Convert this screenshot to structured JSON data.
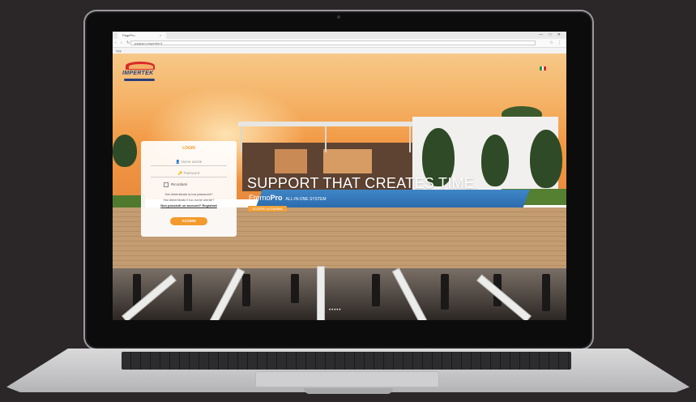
{
  "browser": {
    "tab_title": "PagePro",
    "tab_close": "×",
    "window_controls": "—  □  ✕",
    "nav": "‹ › ↻",
    "url": "pagepro.impertek.it",
    "toolbar_icons": "☆ ⋮",
    "bookmarks": "App"
  },
  "site": {
    "brand": "IMPERTEK",
    "language_flag_colors": [
      "#1f9a4a",
      "#ffffff",
      "#d62b2b"
    ],
    "login": {
      "title": "LOGIN",
      "username_placeholder": "Nome utente",
      "password_placeholder": "Password",
      "remember_label": "Ricordami",
      "forgot_text": "Hai dimenticato la tua password?",
      "help_text": "Hai dimenticato il tuo nome utente?",
      "register_text": "Non possiedi un account? Registrati",
      "submit_label": "ACCEDI"
    },
    "hero": {
      "headline": "SUPPORT THAT CREATES TIME.",
      "product_prefix": "Eterno",
      "product_suffix": "Pro",
      "system_label": "ALL-IN-ONE SYSTEM",
      "cta_label": "SCOPRI LA GAMMA",
      "carousel_dots": "•••••"
    }
  },
  "colors": {
    "accent": "#f39a2e",
    "brand_blue": "#2a3f7a",
    "brand_red": "#d92a2a"
  }
}
